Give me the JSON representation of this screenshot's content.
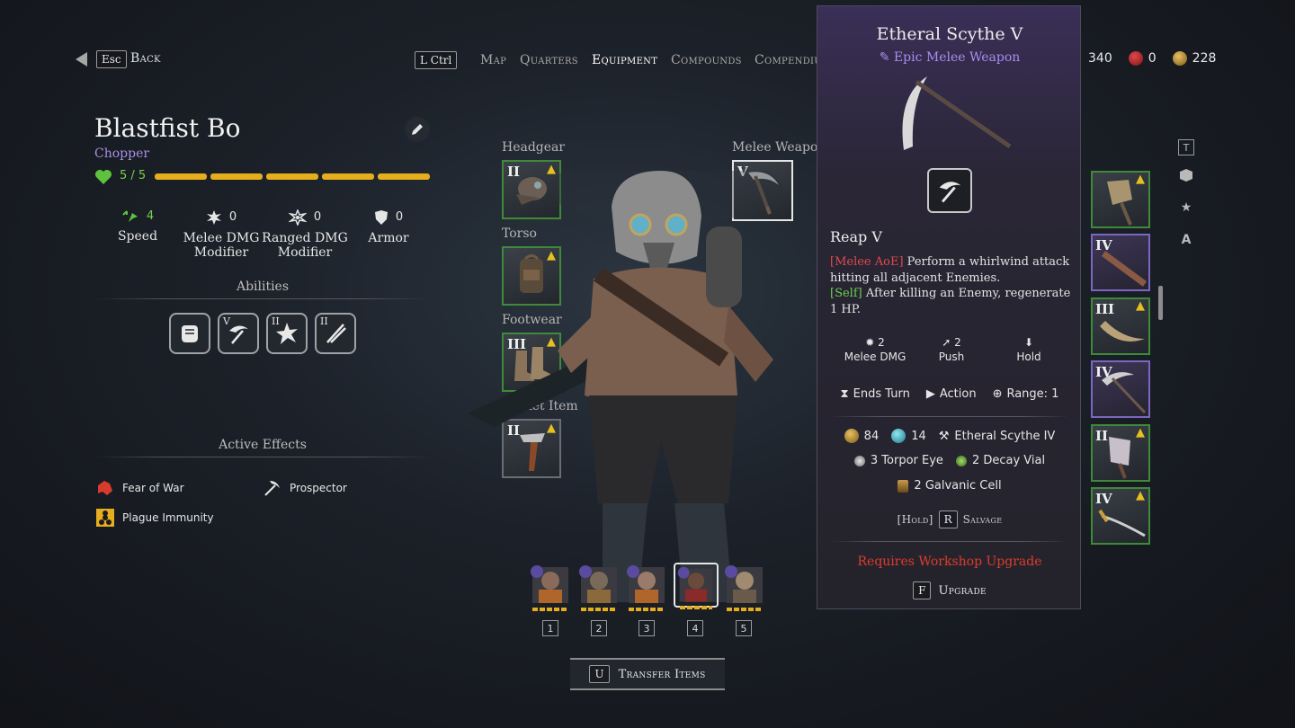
{
  "topbar": {
    "esc_key": "Esc",
    "back_label": "Back",
    "lctrl_key": "L Ctrl",
    "nav": [
      "Map",
      "Quarters",
      "Equipment",
      "Compounds",
      "Compendiu"
    ],
    "active_nav": "Equipment",
    "currency": [
      {
        "icon": "coin-icon",
        "value": "340"
      },
      {
        "icon": "blood-gem-icon",
        "value": "0",
        "color": "#c0282c"
      },
      {
        "icon": "scrap-icon",
        "value": "228",
        "color": "#c8a040"
      }
    ]
  },
  "character": {
    "name": "Blastfist Bo",
    "class": "Chopper",
    "hp_text": "5 / 5",
    "hp_segments": 5,
    "stats": [
      {
        "icon": "speed-icon",
        "value": "4",
        "label1": "Speed",
        "label2": ""
      },
      {
        "icon": "melee-dmg-icon",
        "value": "0",
        "label1": "Melee DMG",
        "label2": "Modifier"
      },
      {
        "icon": "ranged-dmg-icon",
        "value": "0",
        "label1": "Ranged DMG",
        "label2": "Modifier"
      },
      {
        "icon": "armor-icon",
        "value": "0",
        "label1": "Armor",
        "label2": ""
      }
    ],
    "abilities_title": "Abilities",
    "abilities": [
      {
        "icon": "fist-ability-icon",
        "tier": ""
      },
      {
        "icon": "reap-ability-icon",
        "tier": "V"
      },
      {
        "icon": "blast-ability-icon",
        "tier": "II"
      },
      {
        "icon": "slash-ability-icon",
        "tier": "II"
      }
    ],
    "effects_title": "Active Effects",
    "effects": [
      {
        "icon": "fear-of-war-icon",
        "label": "Fear of War"
      },
      {
        "icon": "pickaxe-icon",
        "label": "Prospector"
      },
      {
        "icon": "plague-immunity-icon",
        "label": "Plague Immunity"
      }
    ]
  },
  "equipment": {
    "slots": [
      {
        "label": "Headgear",
        "tier": "II",
        "icon": "plague-mask-icon"
      },
      {
        "label": "Torso",
        "tier": "",
        "icon": "backpack-icon"
      },
      {
        "label": "Footwear",
        "tier": "III",
        "icon": "boots-icon"
      },
      {
        "label": "Pocket Item",
        "tier": "II",
        "icon": "razor-icon"
      }
    ],
    "weapon_label": "Melee Weapon",
    "weapon_tier": "V"
  },
  "party": {
    "members": [
      "1",
      "2",
      "3",
      "4",
      "5"
    ],
    "selected": 4,
    "transfer_key": "U",
    "transfer_label": "Transfer Items"
  },
  "tooltip": {
    "title": "Etheral Scythe V",
    "subtitle": "Epic Melee Weapon",
    "rarity_color": "#a98df0",
    "ability_name": "Reap V",
    "desc_tag1": "[Melee AoE]",
    "desc_text1": " Perform a whirlwind attack hitting all adjacent Enemies.",
    "desc_tag2": "[Self]",
    "desc_text2": " After killing an Enemy, regenerate 1 HP.",
    "stats": [
      {
        "icon": "melee-dmg-icon",
        "value": "2",
        "label": "Melee DMG"
      },
      {
        "icon": "push-icon",
        "value": "2",
        "label": "Push"
      },
      {
        "icon": "hold-icon",
        "value": "",
        "label": "Hold"
      }
    ],
    "flags": [
      {
        "icon": "hourglass-icon",
        "label": "Ends Turn"
      },
      {
        "icon": "play-icon",
        "label": "Action"
      },
      {
        "icon": "range-icon",
        "label": "Range: 1"
      }
    ],
    "materials_row1": [
      {
        "icon": "scrap-icon",
        "value": "84"
      },
      {
        "icon": "crystal-icon",
        "value": "14"
      },
      {
        "icon": "scythe-icon",
        "value": "Etheral Scythe IV"
      }
    ],
    "materials_row2": [
      {
        "icon": "torpor-eye-icon",
        "value": "3 Torpor Eye"
      },
      {
        "icon": "decay-vial-icon",
        "value": "2 Decay Vial"
      }
    ],
    "materials_row3": [
      {
        "icon": "galvanic-cell-icon",
        "value": "2 Galvanic Cell"
      }
    ],
    "salvage_hold": "[Hold]",
    "salvage_key": "R",
    "salvage_label": "Salvage",
    "requirement": "Requires Workshop Upgrade",
    "upgrade_key": "F",
    "upgrade_label": "Upgrade"
  },
  "inventory": [
    {
      "tier": "",
      "upgrade": true,
      "icon": "shovel-icon",
      "rarity": "common"
    },
    {
      "tier": "IV",
      "upgrade": false,
      "icon": "club-icon",
      "rarity": "epic"
    },
    {
      "tier": "III",
      "upgrade": true,
      "icon": "horn-blade-icon",
      "rarity": "common"
    },
    {
      "tier": "IV",
      "upgrade": false,
      "icon": "scythe-icon",
      "rarity": "epic"
    },
    {
      "tier": "II",
      "upgrade": true,
      "icon": "cleaver-icon",
      "rarity": "common"
    },
    {
      "tier": "IV",
      "upgrade": true,
      "icon": "saber-icon",
      "rarity": "common"
    }
  ],
  "side_filters": [
    {
      "icon": "text-filter-icon",
      "label": "T"
    },
    {
      "icon": "box-filter-icon",
      "label": ""
    },
    {
      "icon": "star-filter-icon",
      "label": "★"
    },
    {
      "icon": "sort-filter-icon",
      "label": "A"
    }
  ]
}
